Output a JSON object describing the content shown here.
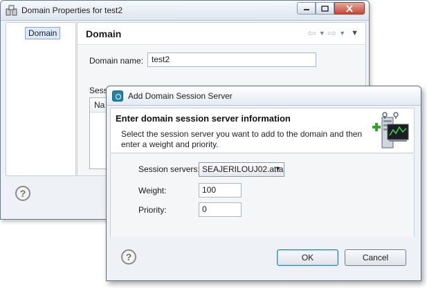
{
  "back_window": {
    "title": "Domain Properties for test2",
    "tree_item": "Domain",
    "page_title": "Domain",
    "domain_name_label": "Domain name:",
    "domain_name_value": "test2",
    "sessions_label": "Sessi",
    "sessions_column": "Na",
    "help": "?"
  },
  "dialog": {
    "title": "Add Domain Session Server",
    "banner_title": "Enter domain session server information",
    "banner_desc": "Select the session server you want to add to the domain and then enter a weight and priority.",
    "session_servers_label": "Session servers:",
    "session_servers_value": "SEAJERILOUJ02.atta",
    "weight_label": "Weight:",
    "weight_value": "100",
    "priority_label": "Priority:",
    "priority_value": "0",
    "help": "?",
    "ok_label": "OK",
    "cancel_label": "Cancel"
  },
  "colors": {
    "accent": "#3c7fb1",
    "close_button": "#c5473a",
    "dialog_icon": "#1f86a8"
  },
  "icons": [
    "app-icon",
    "minimize-icon",
    "maximize-icon",
    "close-icon",
    "back-arrow-icon",
    "forward-arrow-icon",
    "view-menu-icon",
    "help-icon",
    "dialog-icon",
    "server-add-graphic",
    "dropdown-arrow-icon"
  ]
}
